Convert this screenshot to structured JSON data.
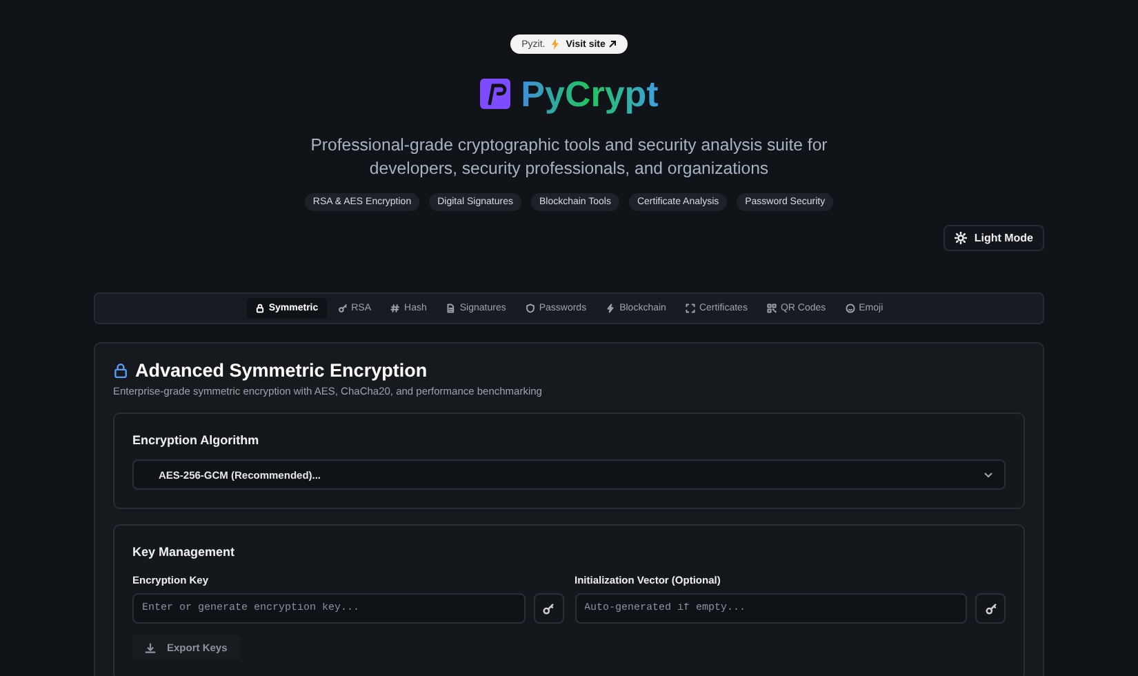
{
  "promo": {
    "brand": "Pyzit.",
    "link": "Visit site"
  },
  "logo": {
    "title": "PyCrypt"
  },
  "tagline": "Professional-grade cryptographic tools and security analysis suite for developers, security professionals, and organizations",
  "features": [
    "RSA & AES Encryption",
    "Digital Signatures",
    "Blockchain Tools",
    "Certificate Analysis",
    "Password Security"
  ],
  "theme_button": {
    "label": "Light Mode"
  },
  "tabs": [
    {
      "label": "Symmetric",
      "selected": true
    },
    {
      "label": "RSA",
      "selected": false
    },
    {
      "label": "Hash",
      "selected": false
    },
    {
      "label": "Signatures",
      "selected": false
    },
    {
      "label": "Passwords",
      "selected": false
    },
    {
      "label": "Blockchain",
      "selected": false
    },
    {
      "label": "Certificates",
      "selected": false
    },
    {
      "label": "QR Codes",
      "selected": false
    },
    {
      "label": "Emoji",
      "selected": false
    }
  ],
  "card": {
    "title": "Advanced Symmetric Encryption",
    "subtitle": "Enterprise-grade symmetric encryption with AES, ChaCha20, and performance benchmarking",
    "algorithm": {
      "heading": "Encryption Algorithm",
      "value": "AES-256-GCM (Recommended)..."
    },
    "keys": {
      "heading": "Key Management",
      "fields": [
        {
          "label": "Encryption Key",
          "placeholder": "Enter or generate encryption key..."
        },
        {
          "label": "Initialization Vector (Optional)",
          "placeholder": "Auto-generated if empty..."
        }
      ],
      "export_button": "Export Keys"
    }
  }
}
